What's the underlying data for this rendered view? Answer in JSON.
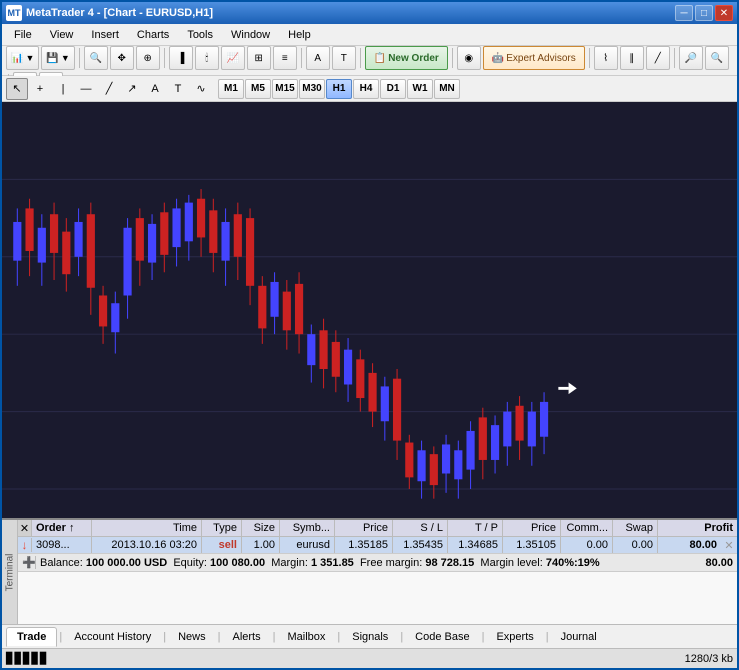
{
  "window": {
    "title": "MetaTrader 4"
  },
  "titleBar": {
    "title": "MetaTrader 4 - [Chart - EURUSD,H1]",
    "minBtn": "─",
    "maxBtn": "□",
    "closeBtn": "✕"
  },
  "menuBar": {
    "items": [
      "File",
      "View",
      "Insert",
      "Charts",
      "Tools",
      "Window",
      "Help"
    ]
  },
  "toolbar": {
    "newOrderLabel": "New Order",
    "expertAdvisorsLabel": "Expert Advisors"
  },
  "timeframes": {
    "buttons": [
      "M1",
      "M5",
      "M15",
      "M30",
      "H1",
      "H4",
      "D1",
      "W1",
      "MN"
    ],
    "active": "H1"
  },
  "table": {
    "headers": [
      "Order",
      "/",
      "Time",
      "Type",
      "Size",
      "Symb...",
      "Price",
      "S / L",
      "T / P",
      "Price",
      "Comm...",
      "Swap",
      "Profit"
    ],
    "rows": [
      {
        "type": "sell",
        "order": "3098...",
        "time": "2013.10.16 03:20",
        "side": "sell",
        "size": "1.00",
        "symbol": "eurusd",
        "openPrice": "1.35185",
        "sl": "1.35435",
        "tp": "1.34685",
        "closePrice": "1.35105",
        "commission": "0.00",
        "swap": "0.00",
        "profit": "80.00"
      }
    ]
  },
  "balance": {
    "balanceLabel": "Balance:",
    "balanceValue": "100 000.00 USD",
    "equityLabel": "Equity:",
    "equityValue": "100 080.00",
    "marginLabel": "Margin:",
    "marginValue": "1 351.85",
    "freeMarginLabel": "Free margin:",
    "freeMarginValue": "98 728.15",
    "marginLevelLabel": "Margin level:",
    "marginLevelValue": "740%:19%",
    "profitValue": "80.00"
  },
  "bottomTabs": {
    "items": [
      "Trade",
      "Account History",
      "News",
      "Alerts",
      "Mailbox",
      "Signals",
      "Code Base",
      "Experts",
      "Journal"
    ],
    "active": "Trade"
  },
  "statusBar": {
    "rightText": "1280/3 kb"
  },
  "sidePanel": {
    "label": "Terminal"
  }
}
